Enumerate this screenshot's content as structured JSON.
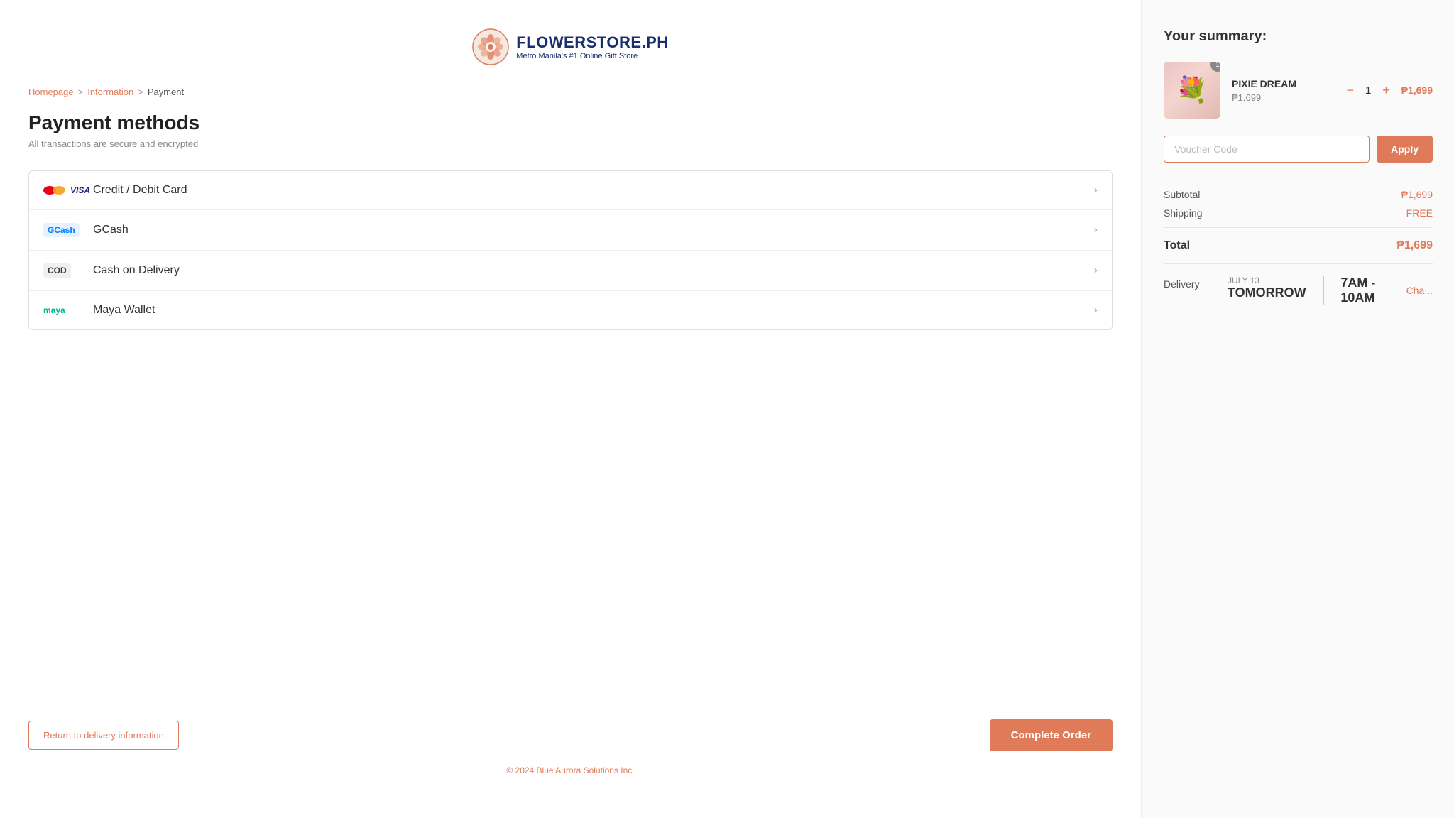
{
  "header": {
    "logo_title": "FLOWERSTORE.PH",
    "logo_subtitle": "Metro Manila's #1 Online Gift Store"
  },
  "breadcrumb": {
    "homepage": "Homepage",
    "information": "Information",
    "payment": "Payment"
  },
  "page": {
    "title": "Payment methods",
    "subtitle": "All transactions are secure and encrypted"
  },
  "payment_methods": [
    {
      "id": "credit-card",
      "label": "Credit / Debit Card",
      "icon_type": "cc"
    },
    {
      "id": "gcash",
      "label": "GCash",
      "icon_type": "gcash"
    },
    {
      "id": "cod",
      "label": "Cash on Delivery",
      "icon_type": "cod"
    },
    {
      "id": "maya",
      "label": "Maya Wallet",
      "icon_type": "maya"
    }
  ],
  "actions": {
    "return_label": "Return to delivery information",
    "complete_label": "Complete Order"
  },
  "footer": {
    "copyright": "© 2024 Blue Aurora Solutions Inc."
  },
  "summary": {
    "title": "Your summary:",
    "product": {
      "name": "PIXIE DREAM",
      "price": "₱1,699",
      "quantity": "1",
      "total": "₱1,699"
    },
    "voucher_placeholder": "Voucher Code",
    "apply_label": "Apply",
    "subtotal_label": "Subtotal",
    "subtotal_value": "₱1,699",
    "shipping_label": "Shipping",
    "shipping_value": "FREE",
    "total_label": "Total",
    "total_value": "₱1,699",
    "delivery_label": "Delivery",
    "delivery_date_day": "JULY 13",
    "delivery_date_name": "TOMORROW",
    "delivery_time": "7AM - 10AM",
    "delivery_change": "Cha..."
  }
}
